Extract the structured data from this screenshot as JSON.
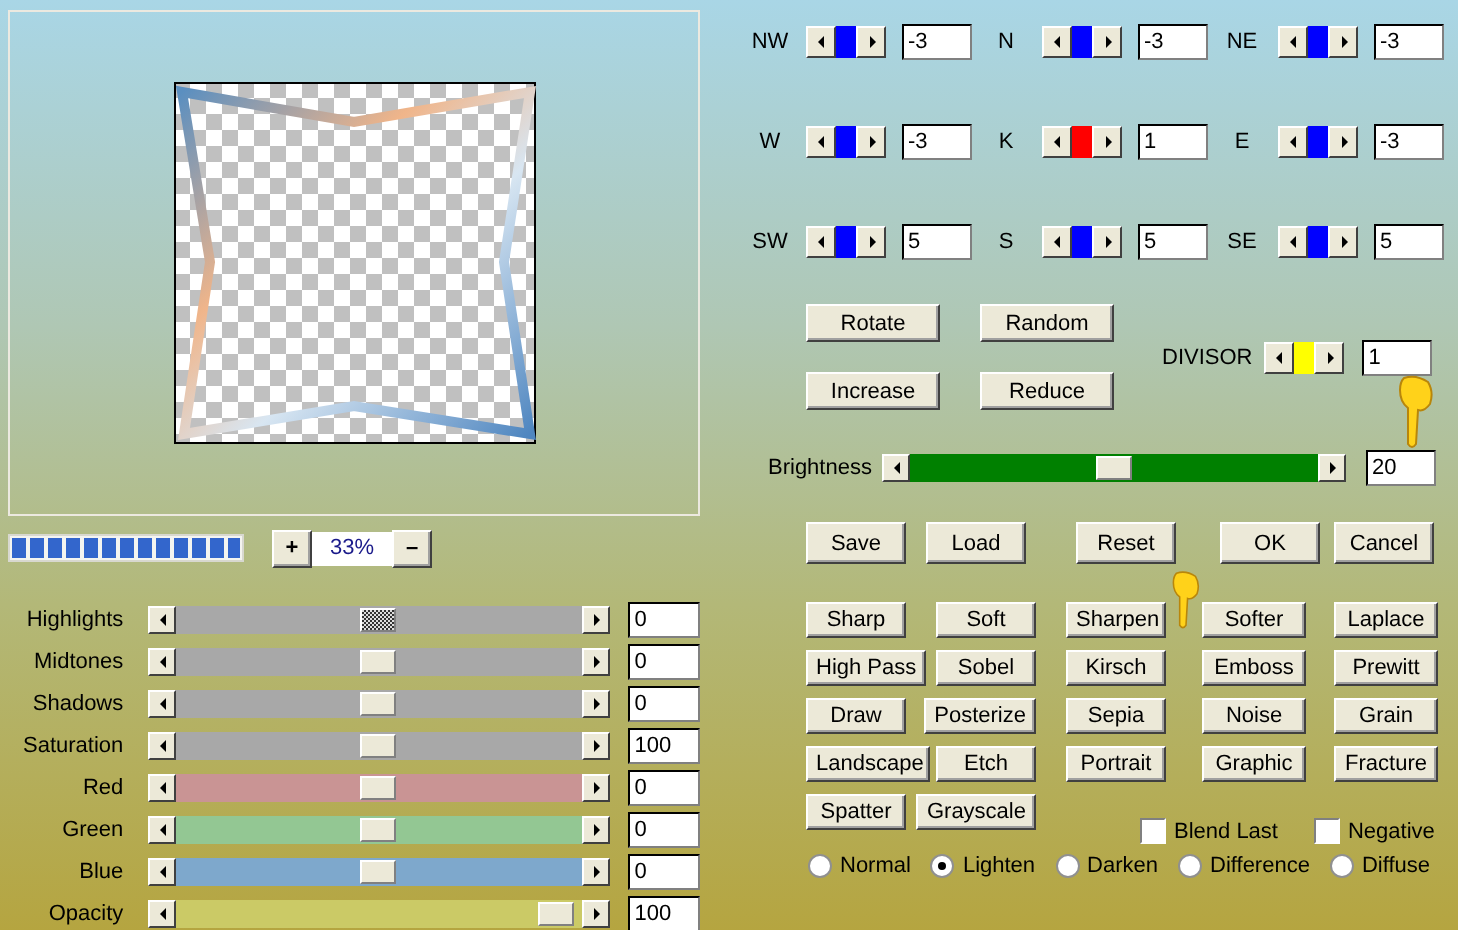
{
  "progress": {
    "level": 1
  },
  "zoom": {
    "plus": "+",
    "value": "33%",
    "minus": "–"
  },
  "adjustments": [
    {
      "label": "Highlights",
      "level": 0.5,
      "value": "0",
      "color": "#a8a8a8",
      "focused": true
    },
    {
      "label": "Midtones",
      "level": 0.5,
      "value": "0",
      "color": "#a8a8a8",
      "focused": false
    },
    {
      "label": "Shadows",
      "level": 0.5,
      "value": "0",
      "color": "#a8a8a8",
      "focused": false
    },
    {
      "label": "Saturation",
      "level": 0.5,
      "value": "100",
      "color": "#a8a8a8",
      "focused": false
    },
    {
      "label": "Red",
      "level": 0.5,
      "value": "0",
      "color": "#c99494",
      "focused": false
    },
    {
      "label": "Green",
      "level": 0.5,
      "value": "0",
      "color": "#93c793",
      "focused": false
    },
    {
      "label": "Blue",
      "level": 0.5,
      "value": "0",
      "color": "#7ea8cc",
      "focused": false
    },
    {
      "label": "Opacity",
      "level": 0.98,
      "value": "100",
      "color": "#cbca66",
      "focused": false
    }
  ],
  "directions": [
    {
      "label": "NW",
      "value": "-3",
      "color": "#0000ff"
    },
    {
      "label": "N",
      "value": "-3",
      "color": "#0000ff"
    },
    {
      "label": "NE",
      "value": "-3",
      "color": "#0000ff"
    },
    {
      "label": "W",
      "value": "-3",
      "color": "#0000ff"
    },
    {
      "label": "K",
      "value": "1",
      "color": "#ff0000"
    },
    {
      "label": "E",
      "value": "-3",
      "color": "#0000ff"
    },
    {
      "label": "SW",
      "value": "5",
      "color": "#0000ff"
    },
    {
      "label": "S",
      "value": "5",
      "color": "#0000ff"
    },
    {
      "label": "SE",
      "value": "5",
      "color": "#0000ff"
    }
  ],
  "transform_buttons": [
    [
      "Rotate",
      "Random"
    ],
    [
      "Increase",
      "Reduce"
    ]
  ],
  "divisor": {
    "label": "DIVISOR",
    "value": "1",
    "color": "#ffff00"
  },
  "brightness": {
    "label": "Brightness",
    "level": 0.5,
    "value": "20"
  },
  "actions": [
    "Save",
    "Load",
    "Reset",
    "OK",
    "Cancel"
  ],
  "filters": [
    [
      "Sharp",
      "Soft",
      "Sharpen",
      "Softer",
      "Laplace"
    ],
    [
      "High Pass",
      "Sobel",
      "Kirsch",
      "Emboss",
      "Prewitt"
    ],
    [
      "Draw",
      "Posterize",
      "Sepia",
      "Noise",
      "Grain"
    ],
    [
      "Landscape",
      "Etch",
      "Portrait",
      "Graphic",
      "Fracture"
    ],
    [
      "Spatter",
      "Grayscale"
    ]
  ],
  "options": [
    {
      "label": "Blend Last",
      "checked": false
    },
    {
      "label": "Negative",
      "checked": false
    }
  ],
  "blend_modes": [
    {
      "label": "Normal",
      "selected": false
    },
    {
      "label": "Lighten",
      "selected": true
    },
    {
      "label": "Darken",
      "selected": false
    },
    {
      "label": "Difference",
      "selected": false
    },
    {
      "label": "Diffuse",
      "selected": false
    }
  ]
}
